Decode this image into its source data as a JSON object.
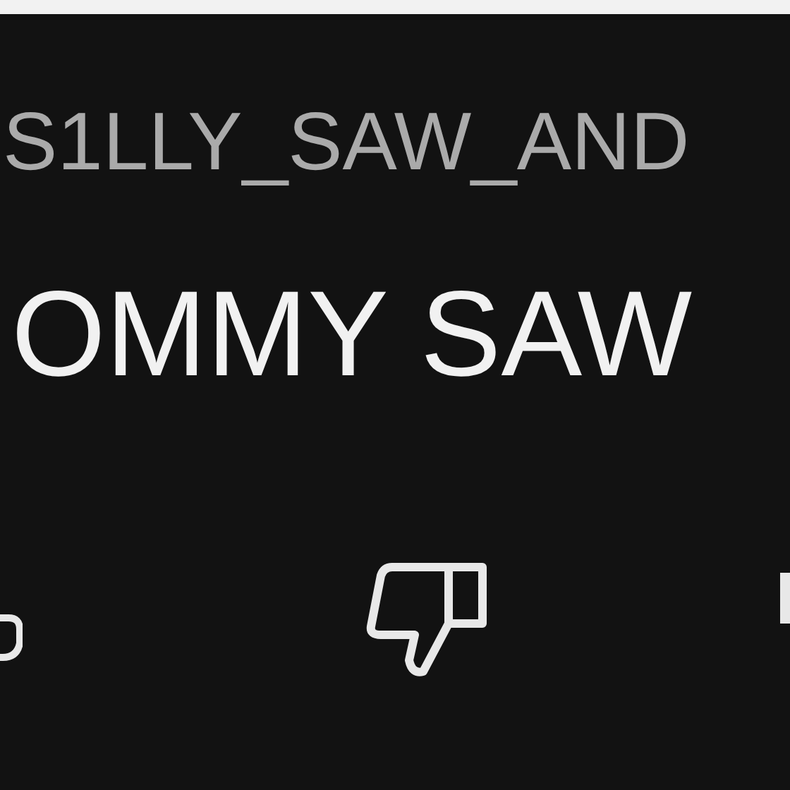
{
  "comment": {
    "author": "S1LLY_SAW_AND",
    "text": "OMMY SAW"
  }
}
